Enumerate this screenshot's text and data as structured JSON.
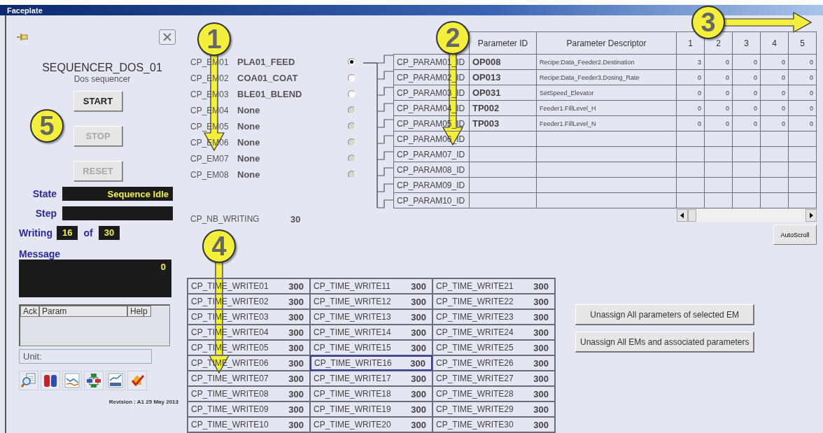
{
  "window": {
    "title": "Faceplate"
  },
  "sequencer": {
    "name": "SEQUENCER_DOS_01",
    "description": "Dos sequencer"
  },
  "commands": [
    {
      "label": "START",
      "disabled": false
    },
    {
      "label": "STOP",
      "disabled": true
    },
    {
      "label": "RESET",
      "disabled": true
    }
  ],
  "state": {
    "label": "State",
    "value": "Sequence Idle"
  },
  "step": {
    "label": "Step"
  },
  "writing": {
    "label": "Writing",
    "current": "16",
    "of": "of",
    "total": "30"
  },
  "message": {
    "label": "Message",
    "value": "0"
  },
  "alarm_list": {
    "columns": [
      "Ack",
      "Param",
      "Help"
    ]
  },
  "unit": {
    "label": "Unit:"
  },
  "revision": "Revision : A1 25 May 2013",
  "equipment_modules": [
    {
      "slot": "CP_EM01",
      "name": "PLA01_FEED",
      "selected": true,
      "disabled": false
    },
    {
      "slot": "CP_EM02",
      "name": "COA01_COAT",
      "selected": false,
      "disabled": false
    },
    {
      "slot": "CP_EM03",
      "name": "BLE01_BLEND",
      "selected": false,
      "disabled": false
    },
    {
      "slot": "CP_EM04",
      "name": "None",
      "selected": false,
      "disabled": true
    },
    {
      "slot": "CP_EM05",
      "name": "None",
      "selected": false,
      "disabled": true
    },
    {
      "slot": "CP_EM06",
      "name": "None",
      "selected": false,
      "disabled": true
    },
    {
      "slot": "CP_EM07",
      "name": "None",
      "selected": false,
      "disabled": true
    },
    {
      "slot": "CP_EM08",
      "name": "None",
      "selected": false,
      "disabled": true
    }
  ],
  "nb_writing": {
    "label": "CP_NB_WRITING",
    "value": "30"
  },
  "parameters": {
    "columns": [
      "Parameter ID",
      "Parameter Descriptor",
      "1",
      "2",
      "3",
      "4",
      "5"
    ],
    "rows": [
      {
        "slot": "CP_PARAM01_ID",
        "id": "OP008",
        "descriptor": "Recipe:Data_Feeder2.Destination",
        "values": [
          "3",
          "0",
          "0",
          "0",
          "0"
        ]
      },
      {
        "slot": "CP_PARAM02_ID",
        "id": "OP013",
        "descriptor": "Recipe:Data_Feeder3.Dosing_Rate",
        "values": [
          "0",
          "0",
          "0",
          "0",
          "0"
        ]
      },
      {
        "slot": "CP_PARAM03_ID",
        "id": "OP031",
        "descriptor": "SetSpeed_Elevator",
        "values": [
          "0",
          "0",
          "0",
          "0",
          "0"
        ]
      },
      {
        "slot": "CP_PARAM04_ID",
        "id": "TP002",
        "descriptor": "Feeder1.FillLevel_H",
        "values": [
          "0",
          "0",
          "0",
          "0",
          "0"
        ]
      },
      {
        "slot": "CP_PARAM05_ID",
        "id": "TP003",
        "descriptor": "Feeder1.FillLevel_N",
        "values": [
          "0",
          "0",
          "0",
          "0",
          "0"
        ]
      },
      {
        "slot": "CP_PARAM06_ID"
      },
      {
        "slot": "CP_PARAM07_ID"
      },
      {
        "slot": "CP_PARAM08_ID"
      },
      {
        "slot": "CP_PARAM09_ID"
      },
      {
        "slot": "CP_PARAM10_ID"
      }
    ]
  },
  "auto_scroll": "AutoScroll",
  "time_writes": [
    {
      "name": "CP_TIME_WRITE01",
      "value": "300",
      "selected": false
    },
    {
      "name": "CP_TIME_WRITE02",
      "value": "300",
      "selected": false
    },
    {
      "name": "CP_TIME_WRITE03",
      "value": "300",
      "selected": false
    },
    {
      "name": "CP_TIME_WRITE04",
      "value": "300",
      "selected": false
    },
    {
      "name": "CP_TIME_WRITE05",
      "value": "300",
      "selected": false
    },
    {
      "name": "CP_TIME_WRITE06",
      "value": "300",
      "selected": false
    },
    {
      "name": "CP_TIME_WRITE07",
      "value": "300",
      "selected": false
    },
    {
      "name": "CP_TIME_WRITE08",
      "value": "300",
      "selected": false
    },
    {
      "name": "CP_TIME_WRITE09",
      "value": "300",
      "selected": false
    },
    {
      "name": "CP_TIME_WRITE10",
      "value": "300",
      "selected": false
    },
    {
      "name": "CP_TIME_WRITE11",
      "value": "300",
      "selected": false
    },
    {
      "name": "CP_TIME_WRITE12",
      "value": "300",
      "selected": false
    },
    {
      "name": "CP_TIME_WRITE13",
      "value": "300",
      "selected": false
    },
    {
      "name": "CP_TIME_WRITE14",
      "value": "300",
      "selected": false
    },
    {
      "name": "CP_TIME_WRITE15",
      "value": "300",
      "selected": false
    },
    {
      "name": "CP_TIME_WRITE16",
      "value": "300",
      "selected": true
    },
    {
      "name": "CP_TIME_WRITE17",
      "value": "300",
      "selected": false
    },
    {
      "name": "CP_TIME_WRITE18",
      "value": "300",
      "selected": false
    },
    {
      "name": "CP_TIME_WRITE19",
      "value": "300",
      "selected": false
    },
    {
      "name": "CP_TIME_WRITE20",
      "value": "300",
      "selected": false
    },
    {
      "name": "CP_TIME_WRITE21",
      "value": "300",
      "selected": false
    },
    {
      "name": "CP_TIME_WRITE22",
      "value": "300",
      "selected": false
    },
    {
      "name": "CP_TIME_WRITE23",
      "value": "300",
      "selected": false
    },
    {
      "name": "CP_TIME_WRITE24",
      "value": "300",
      "selected": false
    },
    {
      "name": "CP_TIME_WRITE25",
      "value": "300",
      "selected": false
    },
    {
      "name": "CP_TIME_WRITE26",
      "value": "300",
      "selected": false
    },
    {
      "name": "CP_TIME_WRITE27",
      "value": "300",
      "selected": false
    },
    {
      "name": "CP_TIME_WRITE28",
      "value": "300",
      "selected": false
    },
    {
      "name": "CP_TIME_WRITE29",
      "value": "300",
      "selected": false
    },
    {
      "name": "CP_TIME_WRITE30",
      "value": "300",
      "selected": false
    }
  ],
  "actions": [
    "Unassign All parameters of selected EM",
    "Unassign All EMs and associated parameters"
  ],
  "callouts": [
    {
      "number": "1",
      "kind": "down"
    },
    {
      "number": "2",
      "kind": "down"
    },
    {
      "number": "3",
      "kind": "right"
    },
    {
      "number": "4",
      "kind": "down"
    },
    {
      "number": "5",
      "kind": "plain"
    }
  ]
}
